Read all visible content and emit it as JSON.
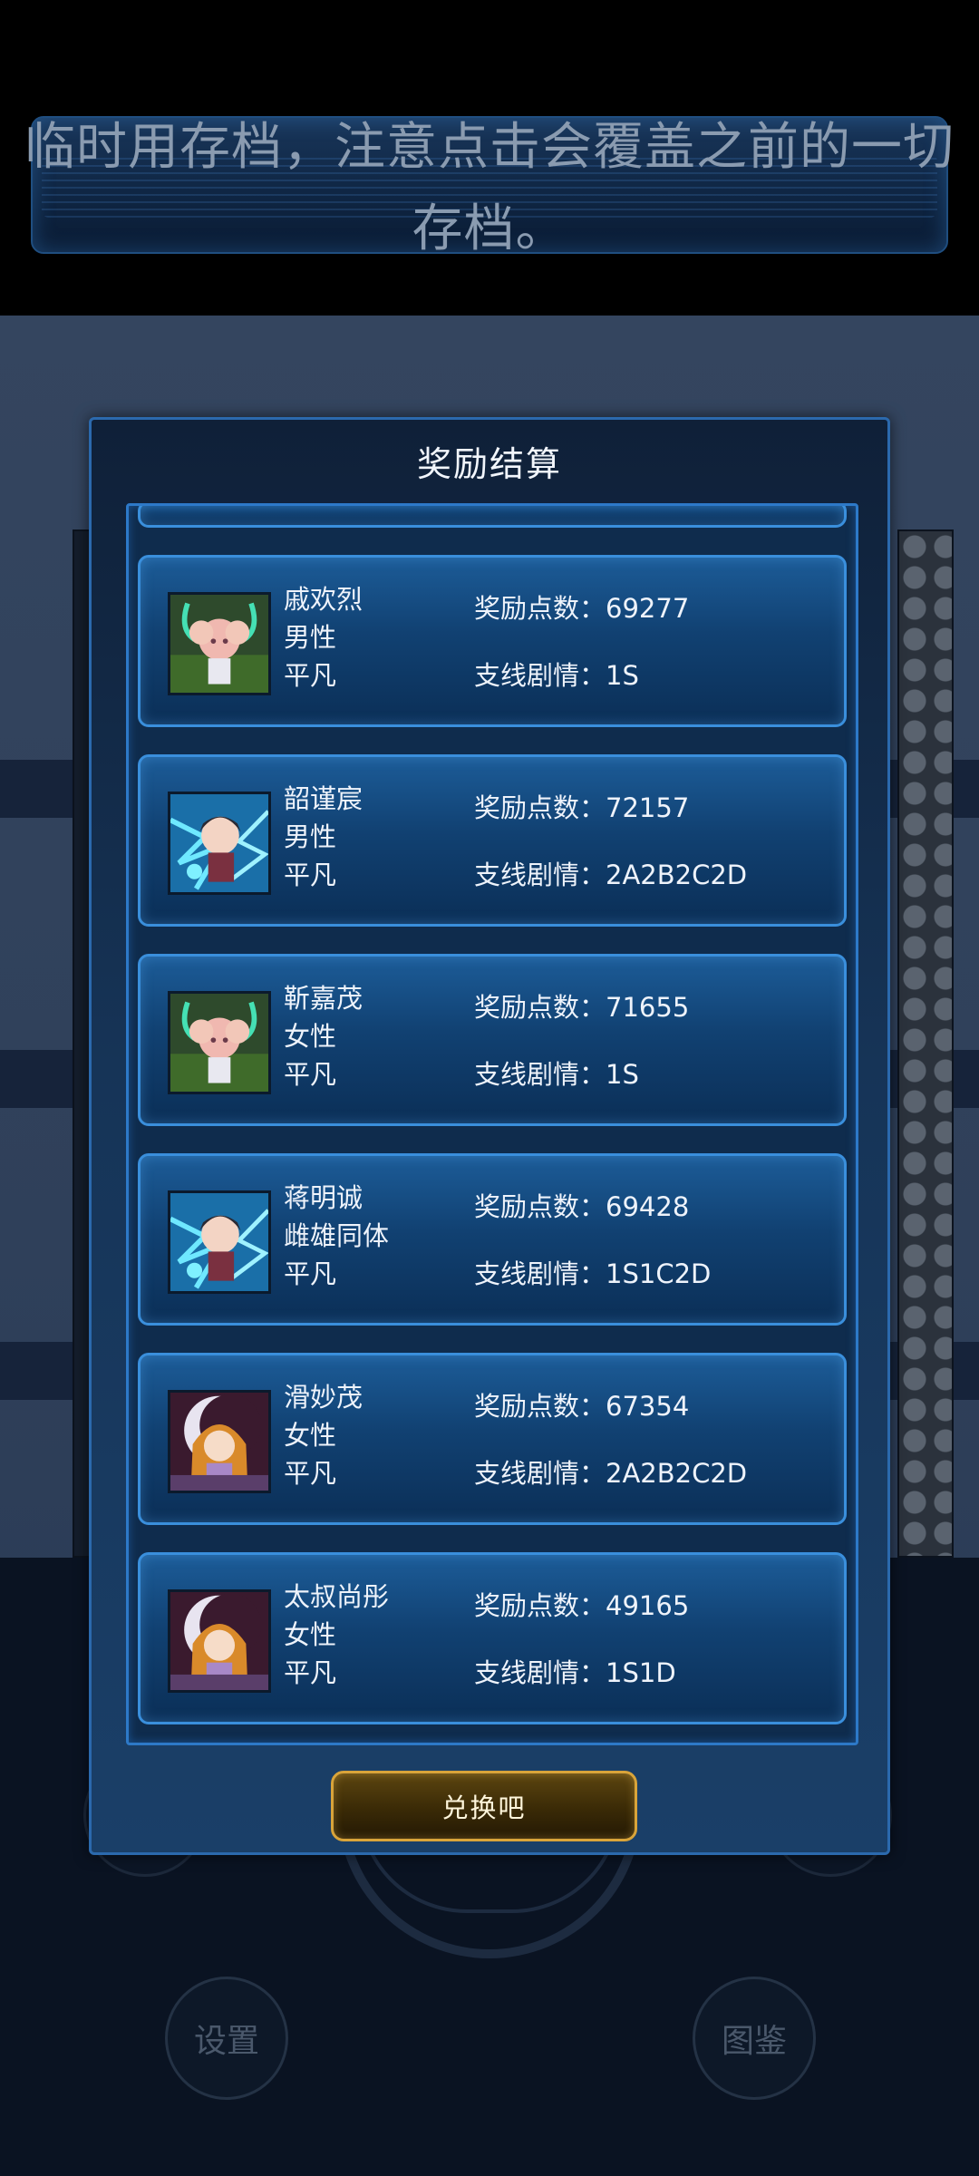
{
  "notice": {
    "text": "临时用存档，注意点击会覆盖之前的一切存档。"
  },
  "background": {
    "settings_label": "设置",
    "gallery_label": "图鉴"
  },
  "dialog": {
    "title": "奖励结算",
    "points_label": "奖励点数：",
    "branch_label": "支线剧情：",
    "redeem_label": "兑换吧",
    "records": [
      {
        "name": "戚欢烈",
        "gender": "男性",
        "rank": "平凡",
        "points": "69277",
        "branch": "1S",
        "portrait": "pink-hair-horned-girl-portrait-icon"
      },
      {
        "name": "韶谨宸",
        "gender": "男性",
        "rank": "平凡",
        "points": "72157",
        "branch": "2A2B2C2D",
        "portrait": "dark-hair-swordsman-portrait-icon"
      },
      {
        "name": "靳嘉茂",
        "gender": "女性",
        "rank": "平凡",
        "points": "71655",
        "branch": "1S",
        "portrait": "pink-hair-horned-girl-portrait-icon"
      },
      {
        "name": "蒋明诚",
        "gender": "雌雄同体",
        "rank": "平凡",
        "points": "69428",
        "branch": "1S1C2D",
        "portrait": "dark-hair-swordsman-portrait-icon"
      },
      {
        "name": "滑妙茂",
        "gender": "女性",
        "rank": "平凡",
        "points": "67354",
        "branch": "2A2B2C2D",
        "portrait": "moon-princess-portrait-icon"
      },
      {
        "name": "太叔尚彤",
        "gender": "女性",
        "rank": "平凡",
        "points": "49165",
        "branch": "1S1D",
        "portrait": "moon-princess-portrait-icon"
      }
    ]
  },
  "colors": {
    "accent_blue": "#3a8fdc",
    "button_gold": "#d9a43a"
  }
}
